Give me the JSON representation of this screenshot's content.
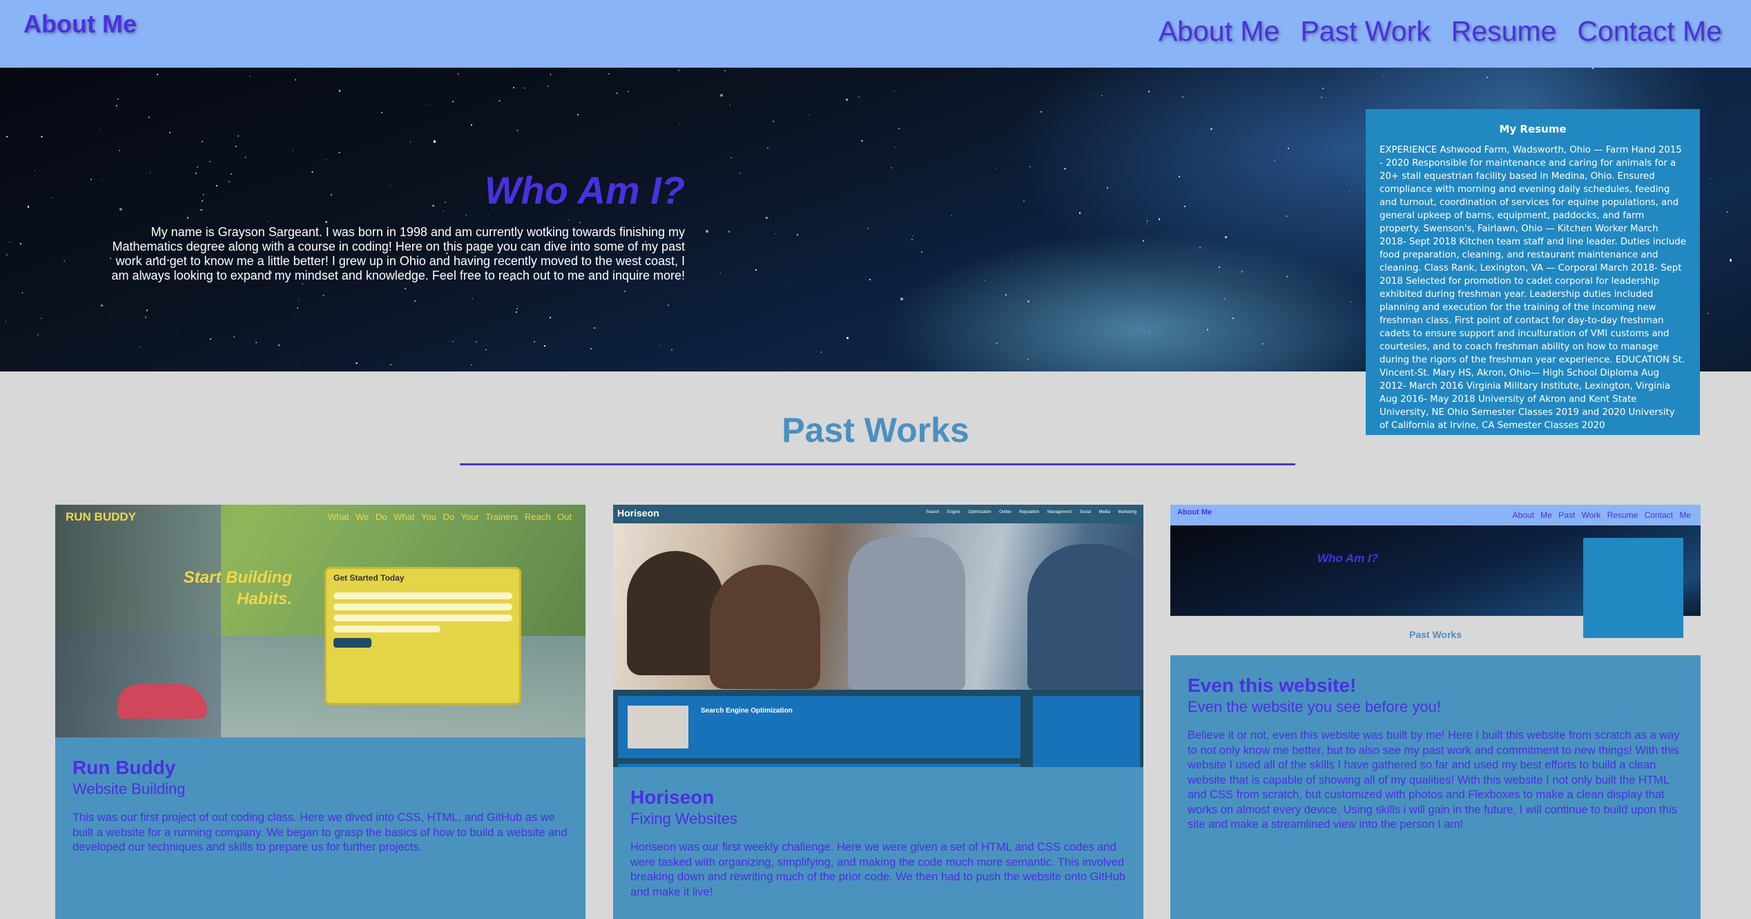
{
  "header": {
    "brand": "About Me",
    "nav": [
      "About Me",
      "Past Work",
      "Resume",
      "Contact Me"
    ]
  },
  "hero": {
    "title": "Who Am I?",
    "text": "My name is Grayson Sargeant. I was born in 1998 and am currently wotking towards finishing my Mathematics degree along with a course in coding! Here on this page you can dive into some of my past work and get to know me a little better! I grew up in Ohio and having recently moved to the west coast, I am always looking to expand my mindset and knowledge. Feel free to reach out to me and inquire more!"
  },
  "resume": {
    "title": "My Resume",
    "text": "EXPERIENCE Ashwood Farm, Wadsworth, Ohio — Farm Hand 2015 - 2020 Responsible for maintenance and caring for animals for a 20+ stall equestrian facility based in Medina, Ohio. Ensured compliance with morning and evening daily schedules, feeding and turnout, coordination of services for equine populations, and general upkeep of barns, equipment, paddocks, and farm property. Swenson's, Fairlawn, Ohio — Kitchen Worker March 2018- Sept 2018 Kitchen team staff and line leader. Duties include food preparation, cleaning, and restaurant maintenance and cleaning. Class Rank, Lexington, VA — Corporal March 2018- Sept 2018 Selected for promotion to cadet corporal for leadership exhibited during freshman year. Leadership duties included planning and execution for the training of the incoming new freshman class. First point of contact for day-to-day freshman cadets to ensure support and inculturation of VMI customs and courtesies, and to coach freshman ability on how to manage during the rigors of the freshman year experience. EDUCATION St. Vincent-St. Mary HS, Akron, Ohio— High School Diploma Aug 2012- March 2016 Virginia Military Institute, Lexington, Virginia Aug 2016- May 2018 University of Akron and Kent State University, NE Ohio Semester Classes 2019 and 2020 University of California at Irvine, CA Semester Classes 2020"
  },
  "past_works": {
    "title": "Past Works",
    "cards": [
      {
        "title": "Run Buddy",
        "subtitle": "Website Building",
        "description": "This was our first project of out coding class. Here we dived into CSS, HTML, and GitHub as we built a website for a running company. We began to grasp the basics of how to build a website and developed our techniques and skills to prepare us for further projects.",
        "preview": {
          "brand": "RUN BUDDY",
          "nav": "What We Do   What You Do   Your Trainers   Reach Out",
          "heading_1": "Start Building",
          "heading_2": "Habits.",
          "form_title": "Get Started Today"
        }
      },
      {
        "title": "Horiseon",
        "subtitle": "Fixing Websites",
        "description": "Horiseon was our first weekly challenge. Here we were given a set of HTML and CSS codes and were tasked with organizing, simplifying, and making the code much more semantic. This involved breaking down and rewriting much of the prior code. We then had to push the website onto GitHub and make it live!",
        "preview": {
          "brand": "Horiseon",
          "nav": "Search Engine Optimization   Online Reputation Management   Social Media Marketing",
          "section_title": "Search Engine Optimization"
        }
      },
      {
        "title": "Even this website!",
        "subtitle": "Even the website you see before you!",
        "description": "Believe it or not, even this website was built by me! Here I built this website from scratch as a way to not only know me better, but to also see my past work and commitment to new things! With this website I used all of the skills I have gathered so far and used my best efforts to build a clean website that is capable of showing all of my qualities! With this website I not only built the HTML and CSS from scratch, but customized with photos and Flexboxes to make a clean display that works on almost every device. Using skills i will gain in the future, I will continue to build upon this site and make a streamlined view into the person I am!",
        "preview": {
          "brand": "About Me",
          "nav": "About Me  Past Work  Resume  Contact Me",
          "who": "Who Am I?",
          "section_title": "Past Works"
        }
      }
    ]
  },
  "colors": {
    "header_bg": "#8ab4f8",
    "accent": "#4b30e0",
    "resume_bg": "#2288c1",
    "card_bg": "#4a93bf",
    "section_title": "#4a90c2",
    "page_bg": "#d8d8d8"
  }
}
